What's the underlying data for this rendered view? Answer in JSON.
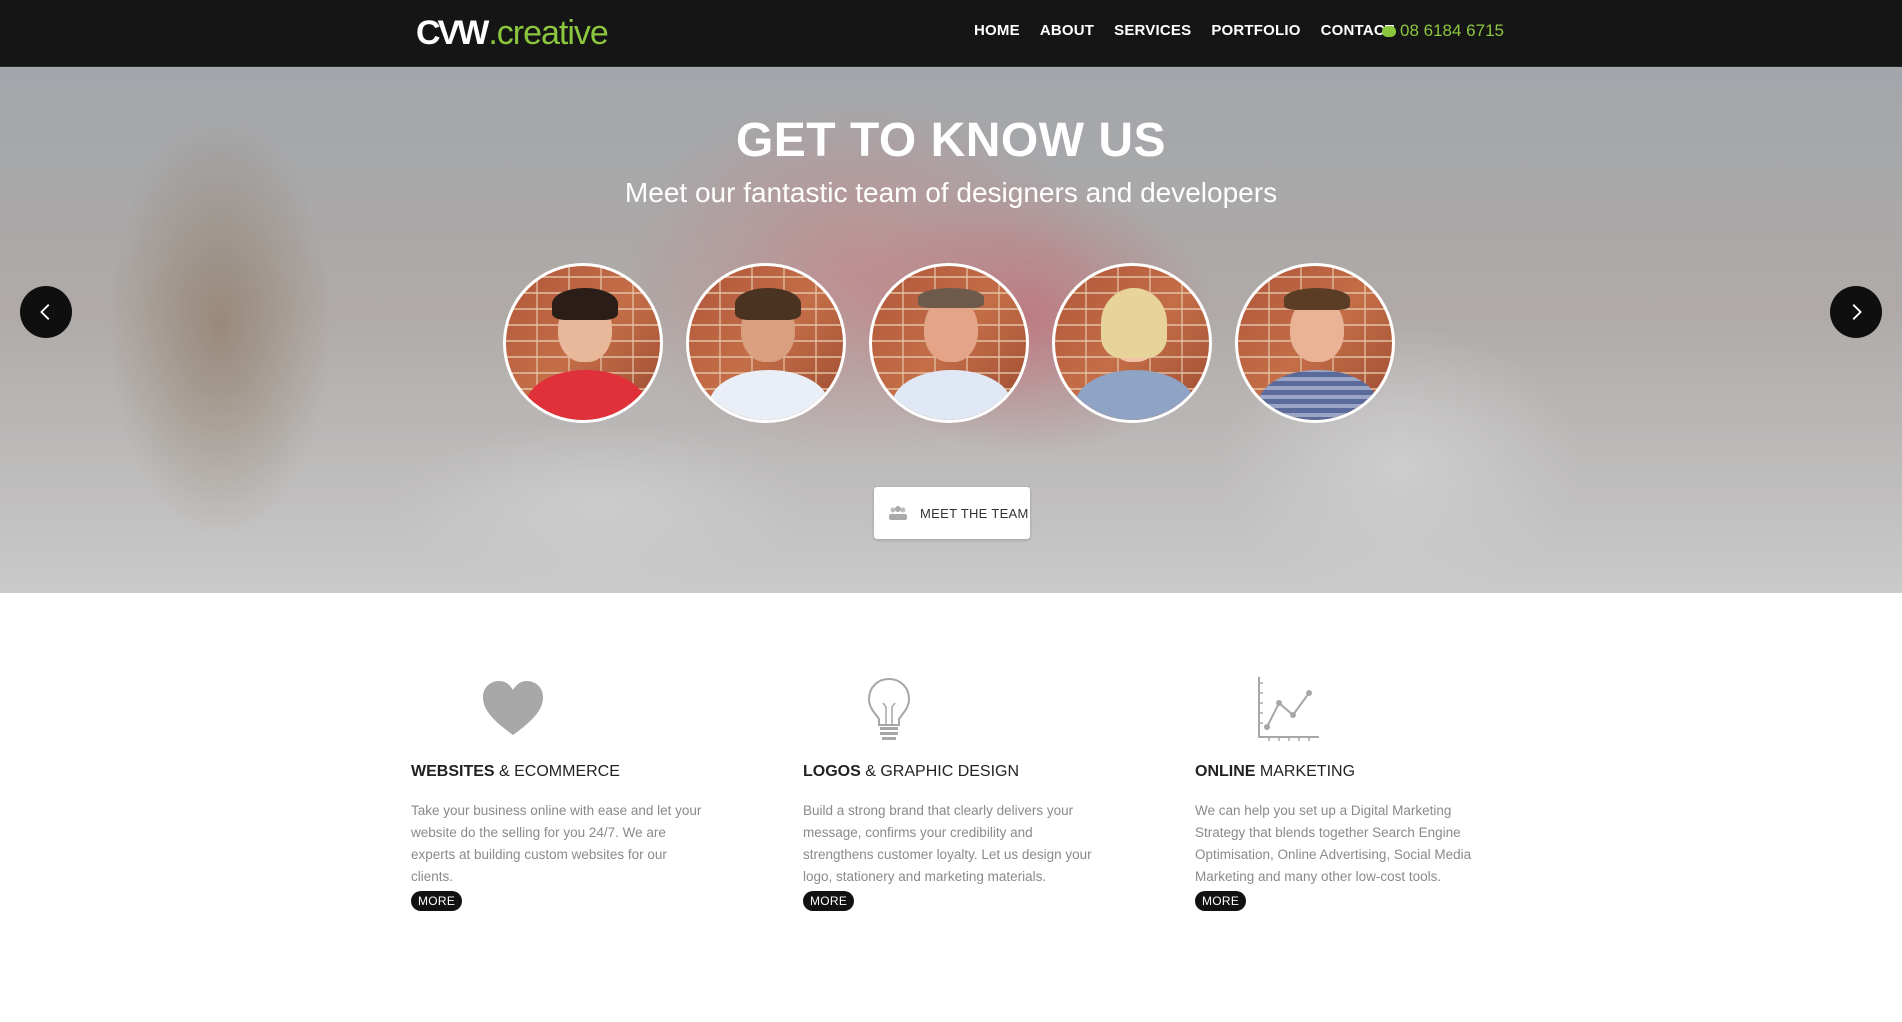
{
  "header": {
    "logo_part1": "CVW",
    "logo_part2": ".creative",
    "nav": [
      "HOME",
      "ABOUT",
      "SERVICES",
      "PORTFOLIO",
      "CONTACT"
    ],
    "phone": "08 6184 6715",
    "accent_color": "#8cc63f"
  },
  "hero": {
    "title": "GET TO KNOW US",
    "subtitle": "Meet our fantastic team of designers and developers",
    "cta_label": "MEET THE TEAM",
    "prev_icon": "chevron-left-icon",
    "next_icon": "chevron-right-icon"
  },
  "services": [
    {
      "icon": "heart-icon",
      "title_bold": "WEBSITES",
      "title_rest": " & ECOMMERCE",
      "description": "Take your business online with ease and let your website do the selling for you 24/7. We are experts at building custom websites for our clients.",
      "more": "MORE"
    },
    {
      "icon": "lightbulb-icon",
      "title_bold": "LOGOS",
      "title_rest": " & GRAPHIC DESIGN",
      "description": "Build a strong brand that clearly delivers your message, confirms your credibility and strengthens customer loyalty. Let us design your logo, stationery and marketing materials.",
      "more": "MORE"
    },
    {
      "icon": "line-chart-icon",
      "title_bold": "ONLINE",
      "title_rest": " MARKETING",
      "description": "We can help you set up a Digital Marketing Strategy that blends together Search Engine Optimisation, Online Advertising, Social Media Marketing and many other low-cost tools.",
      "more": "MORE"
    }
  ]
}
